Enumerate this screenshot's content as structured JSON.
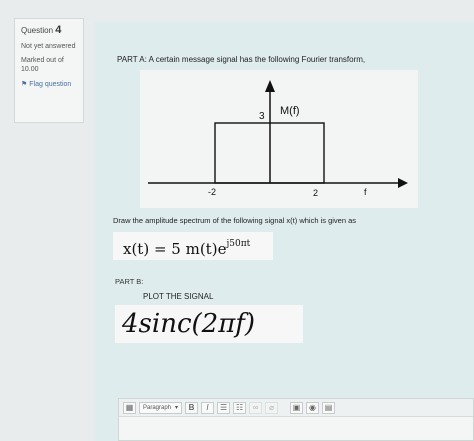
{
  "question_info": {
    "label": "Question",
    "number": "4",
    "status": "Not yet answered",
    "marked_out_of_label": "Marked out of",
    "marked_out_of_value": "10.00",
    "flag_label": "Flag question"
  },
  "part_a": {
    "text": "PART A: A certain message signal has the following Fourier transform,",
    "draw_instruction": "Draw the amplitude spectrum of the following signal x(t) which is given as",
    "equation_lhs": "x(t) = 5 m(t)e",
    "equation_exp": "j50πt"
  },
  "figure": {
    "function_label": "M(f)",
    "height_label": "3",
    "left_tick_label": "-2",
    "right_tick_label": "2",
    "axis_label": "f"
  },
  "part_b": {
    "label": "PART B:",
    "instruction": "PLOT THE SIGNAL",
    "expression": "4sinc(2πf)"
  },
  "editor": {
    "paragraph_label": "Paragraph",
    "bold": "B",
    "italic": "I"
  }
}
